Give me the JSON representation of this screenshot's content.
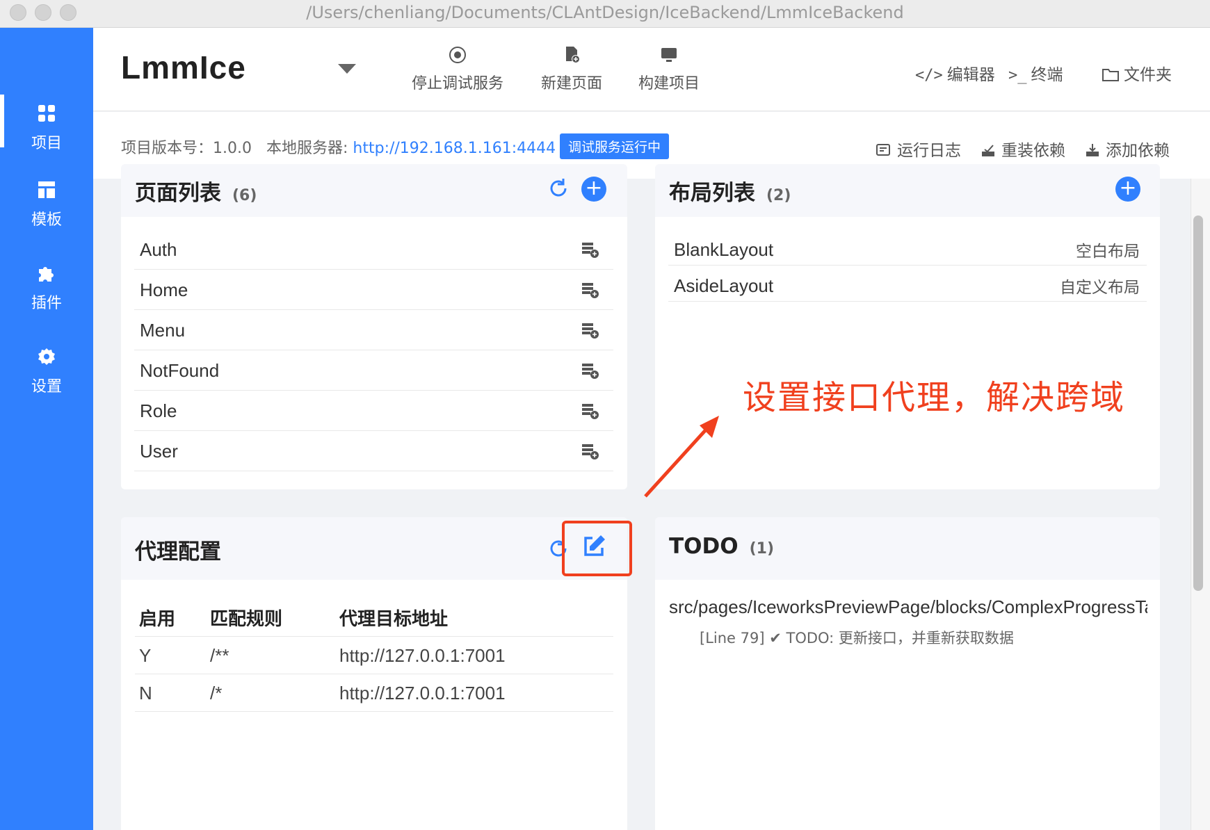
{
  "window": {
    "title": "/Users/chenliang/Documents/CLAntDesign/IceBackend/LmmIceBackend"
  },
  "sidebar": {
    "items": [
      {
        "label": "项目",
        "icon": "grid-icon",
        "active": true
      },
      {
        "label": "模板",
        "icon": "template-icon",
        "active": false
      },
      {
        "label": "插件",
        "icon": "puzzle-icon",
        "active": false
      },
      {
        "label": "设置",
        "icon": "gear-icon",
        "active": false
      }
    ]
  },
  "header": {
    "project_name": "LmmIce",
    "actions": [
      {
        "label": "停止调试服务",
        "icon": "stop-circle-icon"
      },
      {
        "label": "新建页面",
        "icon": "new-page-icon"
      },
      {
        "label": "构建项目",
        "icon": "monitor-icon"
      }
    ],
    "links": [
      {
        "label": "编辑器",
        "icon": "code-icon",
        "glyph": "</>"
      },
      {
        "label": "终端",
        "icon": "terminal-icon",
        "glyph": ">_"
      },
      {
        "label": "文件夹",
        "icon": "folder-icon",
        "glyph": ""
      }
    ]
  },
  "subheader": {
    "version_label": "项目版本号：",
    "version": "1.0.0",
    "server_label": "本地服务器:",
    "server_url": "http://192.168.1.161:4444",
    "status": "调试服务运行中",
    "links": [
      {
        "label": "运行日志",
        "icon": "log-icon"
      },
      {
        "label": "重装依赖",
        "icon": "reinstall-icon"
      },
      {
        "label": "添加依赖",
        "icon": "download-icon"
      }
    ]
  },
  "pages_card": {
    "title": "页面列表",
    "count": "(6)",
    "pages": [
      "Auth",
      "Home",
      "Menu",
      "NotFound",
      "Role",
      "User"
    ]
  },
  "layouts_card": {
    "title": "布局列表",
    "count": "(2)",
    "layouts": [
      {
        "name": "BlankLayout",
        "desc": "空白布局"
      },
      {
        "name": "AsideLayout",
        "desc": "自定义布局"
      }
    ]
  },
  "proxy_card": {
    "title": "代理配置",
    "columns": [
      "启用",
      "匹配规则",
      "代理目标地址"
    ],
    "rows": [
      {
        "enabled": "Y",
        "rule": "/**",
        "target": "http://127.0.0.1:7001"
      },
      {
        "enabled": "N",
        "rule": "/*",
        "target": "http://127.0.0.1:7001"
      }
    ]
  },
  "todo_card": {
    "title": "TODO",
    "count": "(1)",
    "path": "src/pages/IceworksPreviewPage/blocks/ComplexProgressTable",
    "line": "[Line 79] ✔ TODO: 更新接口，并重新获取数据"
  },
  "annotation": {
    "text": "设置接口代理，解决跨域",
    "color": "#f0401e"
  },
  "colors": {
    "accent": "#3080fe",
    "annotation": "#f0401e"
  }
}
